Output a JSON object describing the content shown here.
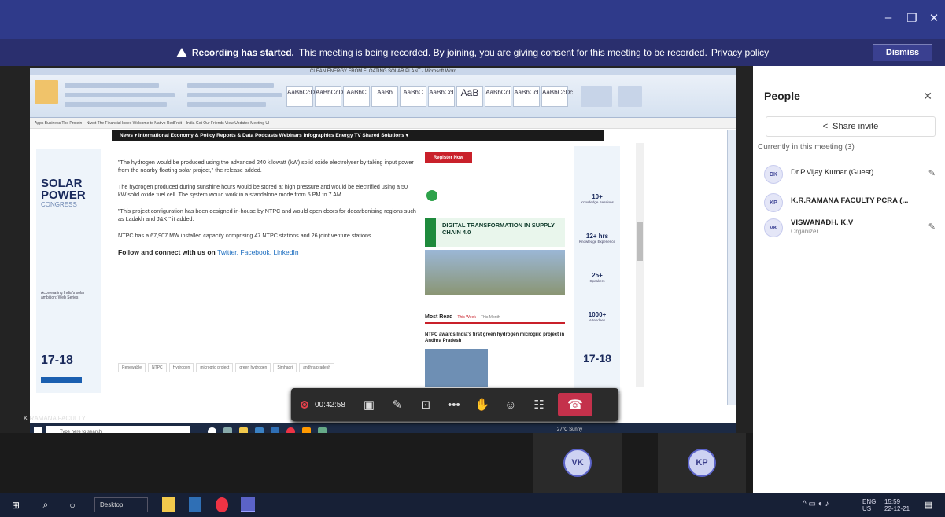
{
  "window": {
    "minimize": "–",
    "maximize": "❐",
    "close": "✕"
  },
  "banner": {
    "title": "Recording has started.",
    "message": "This meeting is being recorded. By joining, you are giving consent for this meeting to be recorded.",
    "link": "Privacy policy",
    "dismiss": "Dismiss"
  },
  "shared_screen": {
    "word_title": "CLEAN ENERGY FROM FLOATING SOLAR PLANT - Microsoft Word",
    "styles": [
      "AaBbCcDc",
      "AaBbCcDc",
      "AaBbC",
      "AaBb",
      "AaBbC",
      "AaBbCcI",
      "AaB",
      "AaBbCcI",
      "AaBbCcI",
      "AaBbCcDc"
    ],
    "bookmarks": "Apps   Business   The Protein – Niwot   The Financial Index   Welcome to Nativo   RedFruit – India   Get Our Friends   View Updates   Meeting UI",
    "nav": "News ▾   International   Economy & Policy   Reports & Data   Podcasts   Webinars   Infographics   Energy TV   Shared Solutions ▾",
    "left_ad": {
      "title": "SOLAR POWER",
      "subtitle": "CONGRESS",
      "blurb": "Accelerating India's solar ambition: Web Series",
      "date": "17-18"
    },
    "article": [
      "\"The hydrogen would be produced using the advanced 240 kilowatt (kW) solid oxide electrolyser by taking input power from the nearby floating solar project,\" the release added.",
      "The hydrogen produced during sunshine hours would be stored at high pressure and would be electrified using a 50 kW solid oxide fuel cell. The system would work in a standalone mode from 5 PM to 7 AM.",
      "\"This project configuration has been designed in-house by NTPC and would open doors for decarbonising regions such as Ladakh and J&K,\" it added.",
      "NTPC has a 67,907 MW installed capacity comprising 47 NTPC stations and 26 joint venture stations."
    ],
    "follow_text": "Follow and connect with us on",
    "follow_links": "Twitter, Facebook, LinkedIn",
    "tags": [
      "Renewable",
      "NTPC",
      "Hydrogen",
      "microgrid project",
      "green hydrogen",
      "Simhadri",
      "andhra pradesh"
    ],
    "mid_ad": {
      "register": "Register Now",
      "dt_title": "DIGITAL TRANSFORMATION IN SUPPLY CHAIN 4.0",
      "most_read": "Most Read",
      "this_week": "This Week",
      "this_month": "This Month",
      "headline": "NTPC awards India's first green hydrogen microgrid project in Andhra Pradesh"
    },
    "stats": [
      {
        "value": "10+",
        "label": "Knowledge Sessions"
      },
      {
        "value": "12+ hrs",
        "label": "Knowledge Experience"
      },
      {
        "value": "25+",
        "label": "Speakers"
      },
      {
        "value": "1000+",
        "label": "Attendees"
      }
    ],
    "right_date": "17-18",
    "taskbar_search": "Type here to search",
    "weather": "27°C Sunny"
  },
  "presenter": "K.RAMANA FACULTY",
  "controls": {
    "timer": "00:42:58",
    "camera": "▣",
    "mic": "✎",
    "share": "⊡",
    "more": "•••",
    "raise_hand": "✋",
    "reactions": "☺",
    "people": "☷",
    "hangup": "☎"
  },
  "tiles": [
    {
      "initials": "VK"
    },
    {
      "initials": "KP"
    }
  ],
  "people": {
    "title": "People",
    "close": "✕",
    "share_invite": "Share invite",
    "current": "Currently in this meeting (3)",
    "list": [
      {
        "initials": "DK",
        "name": "Dr.P.Vijay Kumar (Guest)",
        "role": ""
      },
      {
        "initials": "KP",
        "name": "K.R.RAMANA FACULTY PCRA (...",
        "role": ""
      },
      {
        "initials": "VK",
        "name": "VISWANADH. K.V",
        "role": "Organizer"
      }
    ]
  },
  "taskbar": {
    "desktop": "Desktop",
    "lang": "ENG",
    "region": "US",
    "time": "15:59",
    "date": "22-12-21"
  },
  "colors": {
    "titlebar": "#2f3a8a",
    "banner": "#2a2f6e",
    "hangup": "#c4314b",
    "accent": "#5b63c8"
  }
}
